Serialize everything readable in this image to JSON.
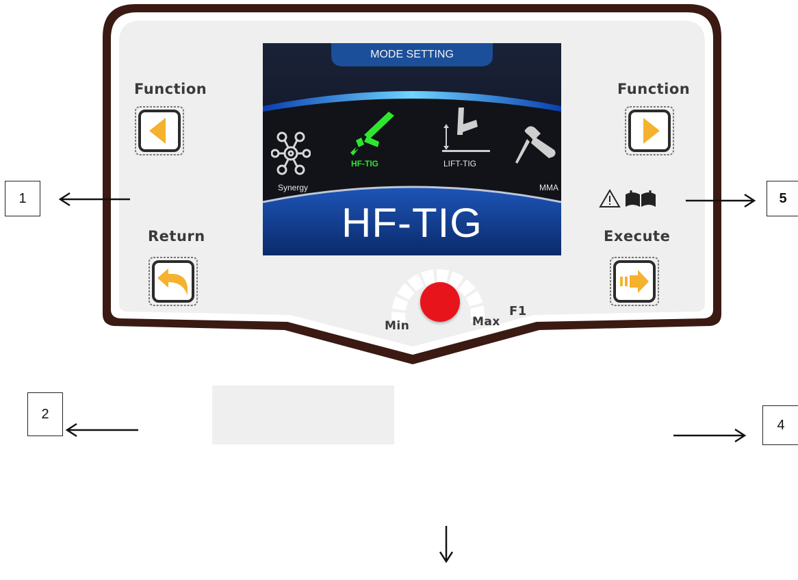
{
  "panel": {
    "left_function_label": "Function",
    "right_function_label": "Function",
    "return_label": "Return",
    "execute_label": "Execute",
    "knob_min_label": "Min",
    "knob_max_label": "Max",
    "f1_label": "F1",
    "warning_icon": "warning-triangle-icon",
    "manual_icon": "open-book-icon",
    "accent_color": "#f5b22e",
    "knob_color": "#e8141b"
  },
  "screen": {
    "header": "MODE SETTING",
    "selected_mode": "HF-TIG",
    "modes": [
      {
        "label": "Synergy",
        "icon": "synergy-gear-icon",
        "selected": false
      },
      {
        "label": "HF-TIG",
        "icon": "hf-tig-torch-icon",
        "selected": true
      },
      {
        "label": "LIFT-TIG",
        "icon": "lift-tig-torch-icon",
        "selected": false
      },
      {
        "label": "MMA",
        "icon": "mma-electrode-icon",
        "selected": false
      }
    ],
    "selected_color": "#2ee62e"
  },
  "callouts": {
    "c1": "1",
    "c2": "2",
    "c4": "4",
    "c5": "5"
  }
}
